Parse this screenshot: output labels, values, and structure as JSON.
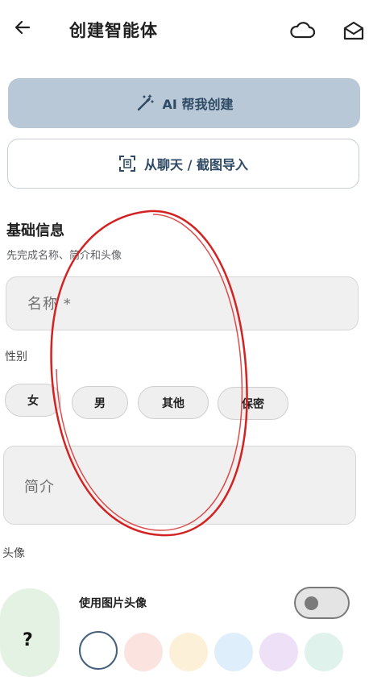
{
  "header": {
    "title": "创建智能体"
  },
  "actions": {
    "ai_create_label": "AI 帮我创建",
    "import_label": "从聊天 / 截图导入"
  },
  "basic_info": {
    "title": "基础信息",
    "subtitle": "先完成名称、简介和头像",
    "name_placeholder": "名称 *",
    "gender_label": "性别",
    "gender_options": [
      "女",
      "男",
      "其他",
      "保密"
    ],
    "bio_placeholder": "简介",
    "avatar_label": "头像",
    "use_image_avatar_label": "使用图片头像",
    "use_image_avatar_enabled": false,
    "avatar_placeholder_glyph": "?"
  },
  "colors": {
    "primary_button_bg": "#b8c8d7",
    "primary_text": "#2e4a64",
    "annotation_stroke": "#d32222",
    "swatches": [
      "#ffffff",
      "#fbe3df",
      "#fdf0d8",
      "#dfeefb",
      "#eee0f7",
      "#dff2ec"
    ]
  }
}
